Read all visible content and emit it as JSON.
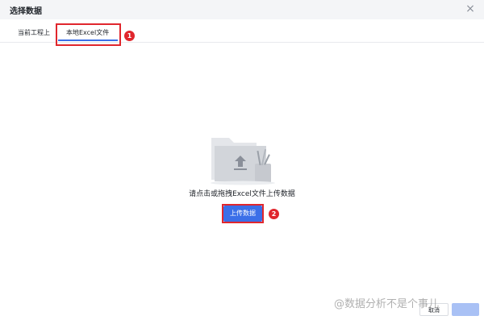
{
  "dialog": {
    "title": "选择数据",
    "close_symbol": "×"
  },
  "tabs": [
    {
      "label": "当前工程上",
      "active": false
    },
    {
      "label": "本地Excel文件",
      "active": true
    }
  ],
  "annotations": {
    "step1": "1",
    "step2": "2",
    "highlight_color": "#e0262d"
  },
  "empty_state": {
    "icon": "folder-upload-icon",
    "hint": "请点击或拖拽Excel文件上传数据",
    "upload_label": "上传数据"
  },
  "footer": {
    "cancel_label": "取消",
    "confirm_label": ""
  },
  "watermark": "@数据分析不是个事儿",
  "colors": {
    "accent": "#3b6fe8",
    "title_bar": "#f4f5f7"
  }
}
